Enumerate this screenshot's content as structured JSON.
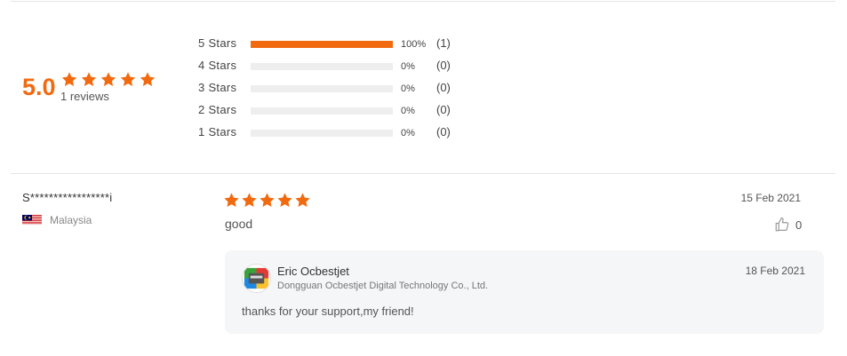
{
  "summary": {
    "score": "5.0",
    "rating": 5,
    "reviews_label": "1 reviews"
  },
  "distribution": [
    {
      "label": "5 Stars",
      "percent_label": "100%",
      "count_label": "(1)",
      "fraction": 1.0
    },
    {
      "label": "4 Stars",
      "percent_label": "0%",
      "count_label": "(0)",
      "fraction": 0
    },
    {
      "label": "3 Stars",
      "percent_label": "0%",
      "count_label": "(0)",
      "fraction": 0
    },
    {
      "label": "2 Stars",
      "percent_label": "0%",
      "count_label": "(0)",
      "fraction": 0
    },
    {
      "label": "1 Stars",
      "percent_label": "0%",
      "count_label": "(0)",
      "fraction": 0
    }
  ],
  "review": {
    "reviewer": "S*****************i",
    "country": "Malaysia",
    "country_flag_icon": "malaysia-flag-icon",
    "rating": 5,
    "text": "good",
    "date": "15 Feb 2021",
    "likes": "0",
    "like_icon": "thumbs-up-icon",
    "reply": {
      "name": "Eric Ocbestjet",
      "company": "Dongguan Ocbestjet Digital Technology Co., Ltd.",
      "date": "18 Feb 2021",
      "text": "thanks for your support,my friend!"
    }
  },
  "colors": {
    "accent": "#f26a10",
    "bar_empty": "#eeeeee",
    "reply_bg": "#f5f6f8"
  }
}
